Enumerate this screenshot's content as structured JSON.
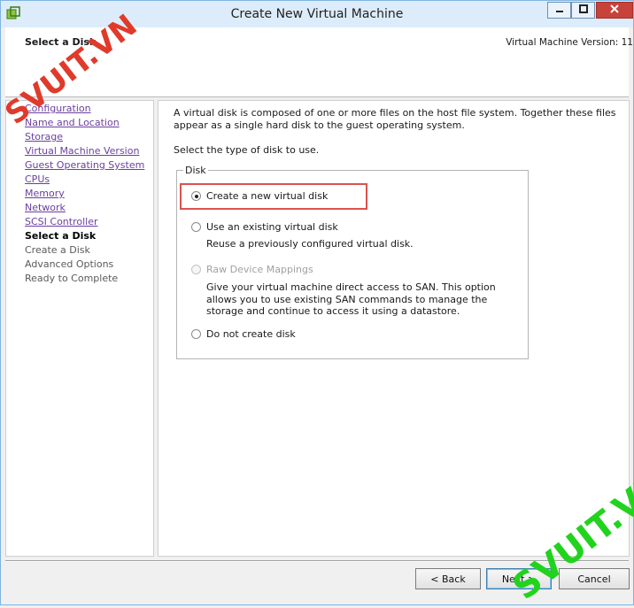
{
  "window": {
    "title": "Create New Virtual Machine",
    "icons": {
      "app": "vm-app-icon",
      "minimize": "minimize-icon",
      "maximize": "maximize-icon",
      "close": "close-icon"
    }
  },
  "header": {
    "step_title": "Select a Disk",
    "version_text": "Virtual Machine Version: 11"
  },
  "sidebar": {
    "items": [
      {
        "label": "Configuration",
        "state": "done"
      },
      {
        "label": "Name and Location",
        "state": "done"
      },
      {
        "label": "Storage",
        "state": "done"
      },
      {
        "label": "Virtual Machine Version",
        "state": "done"
      },
      {
        "label": "Guest Operating System",
        "state": "done"
      },
      {
        "label": "CPUs",
        "state": "done"
      },
      {
        "label": "Memory",
        "state": "done"
      },
      {
        "label": "Network",
        "state": "done"
      },
      {
        "label": "SCSI Controller",
        "state": "done"
      },
      {
        "label": "Select a Disk",
        "state": "current"
      },
      {
        "label": "Create a Disk",
        "state": "future"
      },
      {
        "label": "Advanced Options",
        "state": "future"
      },
      {
        "label": "Ready to Complete",
        "state": "future"
      }
    ]
  },
  "main": {
    "intro": "A virtual disk is composed of one or more files on the host file system. Together these files appear as a single hard disk to the guest operating system.",
    "prompt": "Select the type of disk to use.",
    "group_label": "Disk",
    "options": [
      {
        "label": "Create a new virtual disk",
        "checked": true,
        "disabled": false
      },
      {
        "label": "Use an existing virtual disk",
        "description": "Reuse a previously configured virtual disk.",
        "checked": false,
        "disabled": false
      },
      {
        "label": "Raw Device Mappings",
        "description": "Give your virtual machine direct access to SAN. This option allows you to use existing SAN commands to manage the storage and continue to access it using a datastore.",
        "checked": false,
        "disabled": true
      },
      {
        "label": "Do not create disk",
        "checked": false,
        "disabled": false
      }
    ],
    "highlight_color": "#d9534f"
  },
  "footer": {
    "back_label": "< Back",
    "next_label": "Next >",
    "cancel_label": "Cancel"
  },
  "watermarks": [
    "SVUIT.VN",
    "SVUIT.VN"
  ],
  "colors": {
    "titlebar": "#dcecfb",
    "link_visited": "#6b3fa0",
    "watermark_red": "#e03a2a",
    "watermark_green": "#22d31e"
  }
}
